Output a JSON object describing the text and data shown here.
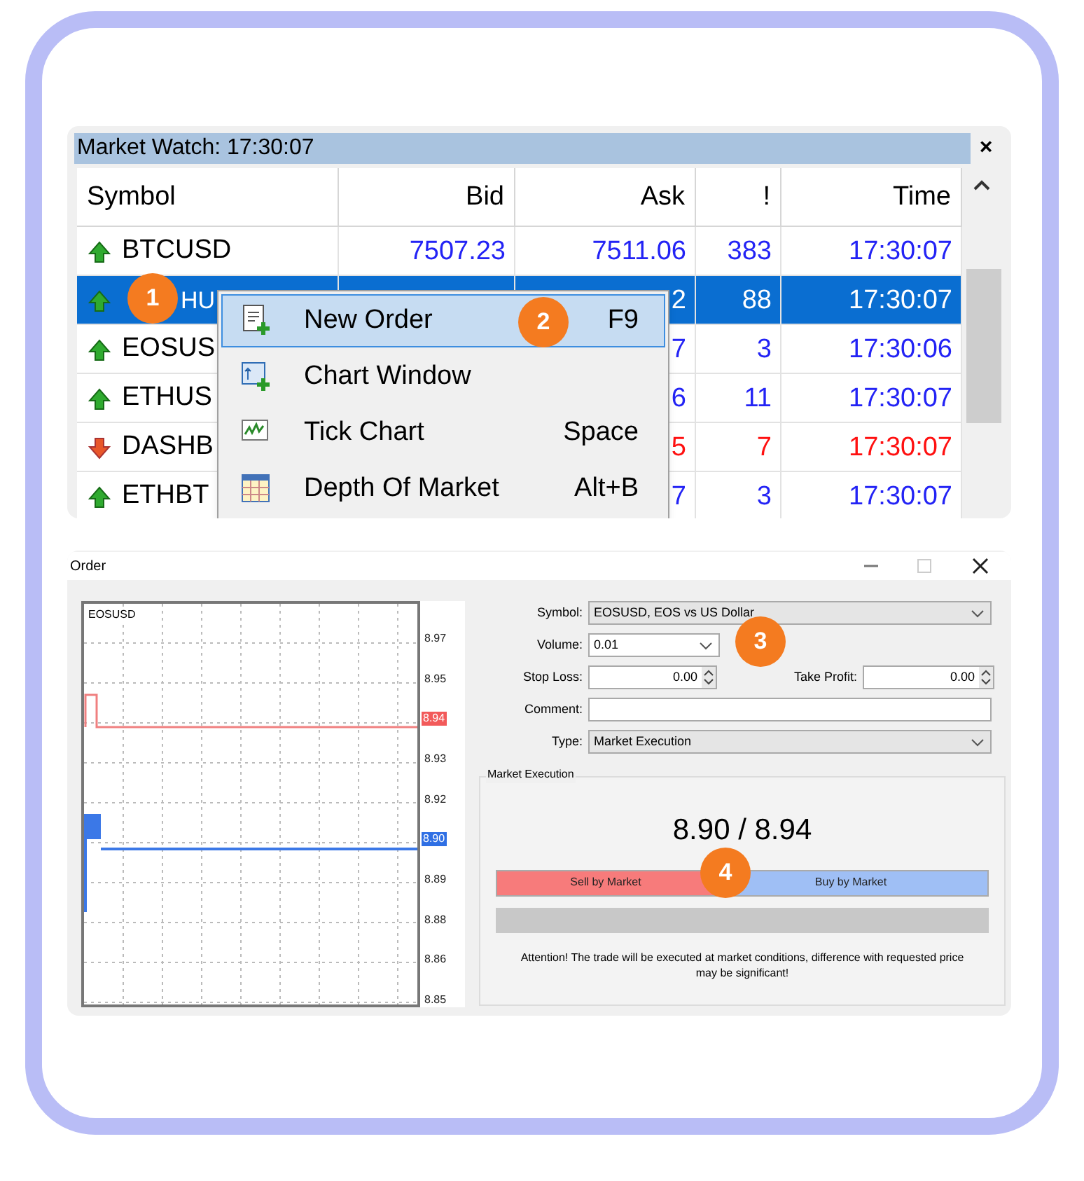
{
  "market_watch": {
    "title": "Market Watch: 17:30:07",
    "close": "×",
    "columns": [
      "Symbol",
      "Bid",
      "Ask",
      "!",
      "Time"
    ],
    "rows": [
      {
        "rising": true,
        "selected": false,
        "symbol": "BTCUSD",
        "bid": "7507.23",
        "ask": "7511.06",
        "spread": "383",
        "time": "17:30:07"
      },
      {
        "rising": true,
        "selected": true,
        "symbol": "HU",
        "bid": "",
        "ask": "2",
        "spread": "88",
        "time": "17:30:07"
      },
      {
        "rising": true,
        "selected": false,
        "symbol": "EOSUS",
        "bid": "",
        "ask": "7",
        "spread": "3",
        "time": "17:30:06"
      },
      {
        "rising": true,
        "selected": false,
        "symbol": "ETHUS",
        "bid": "",
        "ask": "6",
        "spread": "11",
        "time": "17:30:07"
      },
      {
        "rising": false,
        "selected": false,
        "symbol": "DASHB",
        "bid": "",
        "ask": "5",
        "spread": "7",
        "time": "17:30:07"
      },
      {
        "rising": true,
        "selected": false,
        "symbol": "ETHBT",
        "bid": "",
        "ask": "7",
        "spread": "3",
        "time": "17:30:07"
      }
    ],
    "context_menu": [
      {
        "kind": "order",
        "label": "New Order",
        "shortcut": "F9",
        "selected": true
      },
      {
        "kind": "chart",
        "label": "Chart Window",
        "selected": false
      },
      {
        "kind": "tick",
        "label": "Tick Chart",
        "shortcut": "Space",
        "selected": false
      },
      {
        "kind": "depth",
        "label": "Depth Of Market",
        "shortcut": "Alt+B",
        "selected": false
      }
    ]
  },
  "order_window": {
    "title": "Order",
    "chart": {
      "symbol": "EOSUSD",
      "axis": [
        {
          "kind": "tick",
          "label": "8.97"
        },
        {
          "kind": "tick",
          "label": "8.95"
        },
        {
          "kind": "ask_tag",
          "label": "8.94"
        },
        {
          "kind": "tick",
          "label": "8.93"
        },
        {
          "kind": "tick",
          "label": "8.92"
        },
        {
          "kind": "bid_tag",
          "label": "8.90"
        },
        {
          "kind": "tick",
          "label": "8.89"
        },
        {
          "kind": "tick",
          "label": "8.88"
        },
        {
          "kind": "tick",
          "label": "8.86"
        },
        {
          "kind": "tick",
          "label": "8.85"
        }
      ]
    },
    "form": [
      {
        "kind": "select",
        "label": "Symbol:",
        "value": "EOSUSD, EOS vs US Dollar"
      },
      {
        "kind": "combo",
        "label": "Volume:",
        "value": "0.01"
      },
      {
        "kind": "spin_pair",
        "label": "Stop Loss:",
        "value": "0.00",
        "label_2": "Take Profit:",
        "value_2": "0.00"
      },
      {
        "kind": "text",
        "label": "Comment:"
      },
      {
        "kind": "select",
        "label": "Type:",
        "value": "Market Execution"
      }
    ],
    "group": {
      "title": "Market Execution",
      "price": "8.90 / 8.94",
      "sell": "Sell by Market",
      "buy": "Buy by Market",
      "note": "Attention! The trade will be executed at market conditions, difference with requested price may be significant!"
    }
  },
  "steps": [
    "1",
    "2",
    "3",
    "4"
  ]
}
